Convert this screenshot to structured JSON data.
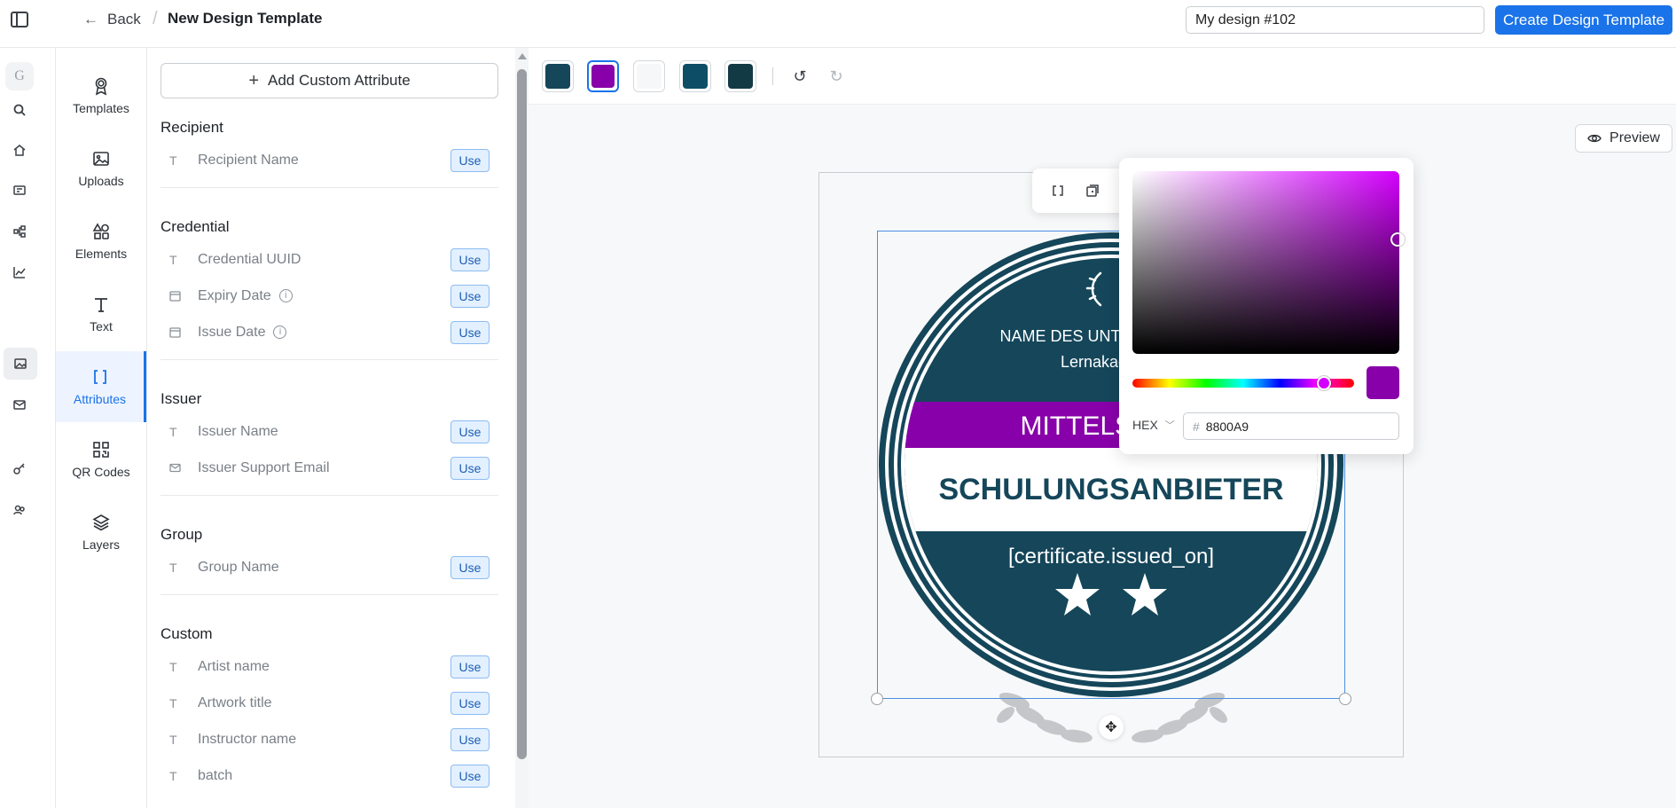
{
  "header": {
    "back_label": "Back",
    "title": "New Design Template",
    "design_name_value": "My design #102",
    "create_label": "Create Design Template"
  },
  "rail": {
    "avatar_letter": "G",
    "icons": [
      "search-icon",
      "home-icon",
      "certificate-icon",
      "workflow-icon",
      "chart-icon",
      "image-icon",
      "mail-icon",
      "key-icon",
      "users-icon"
    ]
  },
  "tools": [
    {
      "label": "Templates",
      "icon": "award-icon"
    },
    {
      "label": "Uploads",
      "icon": "image-icon"
    },
    {
      "label": "Elements",
      "icon": "shapes-icon"
    },
    {
      "label": "Text",
      "icon": "text-icon"
    },
    {
      "label": "Attributes",
      "icon": "brackets-icon",
      "active": true
    },
    {
      "label": "QR Codes",
      "icon": "qr-code-icon"
    },
    {
      "label": "Layers",
      "icon": "layers-icon"
    }
  ],
  "panel": {
    "add_custom_label": "Add Custom Attribute",
    "use_label": "Use",
    "sections": [
      {
        "title": "Recipient",
        "items": [
          {
            "label": "Recipient Name",
            "icon": "text-icon"
          }
        ]
      },
      {
        "title": "Credential",
        "items": [
          {
            "label": "Credential UUID",
            "icon": "text-icon"
          },
          {
            "label": "Expiry Date",
            "icon": "calendar-icon",
            "info": true
          },
          {
            "label": "Issue Date",
            "icon": "calendar-icon",
            "info": true
          }
        ]
      },
      {
        "title": "Issuer",
        "items": [
          {
            "label": "Issuer Name",
            "icon": "text-icon"
          },
          {
            "label": "Issuer Support Email",
            "icon": "mail-icon"
          }
        ]
      },
      {
        "title": "Group",
        "items": [
          {
            "label": "Group Name",
            "icon": "text-icon"
          }
        ]
      },
      {
        "title": "Custom",
        "items": [
          {
            "label": "Artist name",
            "icon": "text-icon"
          },
          {
            "label": "Artwork title",
            "icon": "text-icon"
          },
          {
            "label": "Instructor name",
            "icon": "text-icon"
          },
          {
            "label": "batch",
            "icon": "text-icon"
          }
        ]
      }
    ]
  },
  "canvas": {
    "swatches": [
      "#15465a",
      "#8800a9",
      "#f6f7f8",
      "#0d4e66",
      "#123a45"
    ],
    "selected_swatch": 1,
    "preview_label": "Preview"
  },
  "color_picker": {
    "mode": "HEX",
    "hex_value": "8800A9",
    "hue_color": "#d400ff"
  },
  "badge": {
    "company": "NAME DES UNTERNEHMENS",
    "subtitle": "Lernakademie",
    "level": "MITTELSTUFE",
    "provider": "SCHULUNGSANBIETER",
    "date_placeholder": "[certificate.issued_on]",
    "colors": {
      "primary": "#15465a",
      "accent": "#8800a9",
      "band": "#ffffff",
      "laurel": "#c4c6c9"
    },
    "stars": 2
  }
}
